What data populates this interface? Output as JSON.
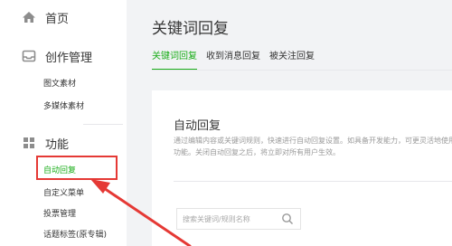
{
  "sidebar": {
    "home": {
      "label": "首页",
      "icon": "home-icon"
    },
    "creation": {
      "label": "创作管理",
      "icon": "inbox-icon",
      "items": [
        "图文素材",
        "多媒体素材"
      ]
    },
    "features": {
      "label": "功能",
      "icon": "grid-icon",
      "items": [
        "自动回复",
        "自定义菜单",
        "投票管理",
        "话题标签(原专辑)"
      ]
    }
  },
  "main": {
    "title": "关键词回复",
    "tabs": [
      "关键词回复",
      "收到消息回复",
      "被关注回复"
    ],
    "panel": {
      "title": "自动回复",
      "description": "通过编辑内容或关键词规则，快速进行自动回复设置。如具备开发能力，可更灵活地使用该功能。关闭自动回复之后，将立即对所有用户生效。",
      "search_placeholder": "搜索关键词/规则名称",
      "search_icon": "magnifier-icon"
    }
  },
  "colors": {
    "accent": "#1aad19",
    "annotation": "#e53935"
  }
}
